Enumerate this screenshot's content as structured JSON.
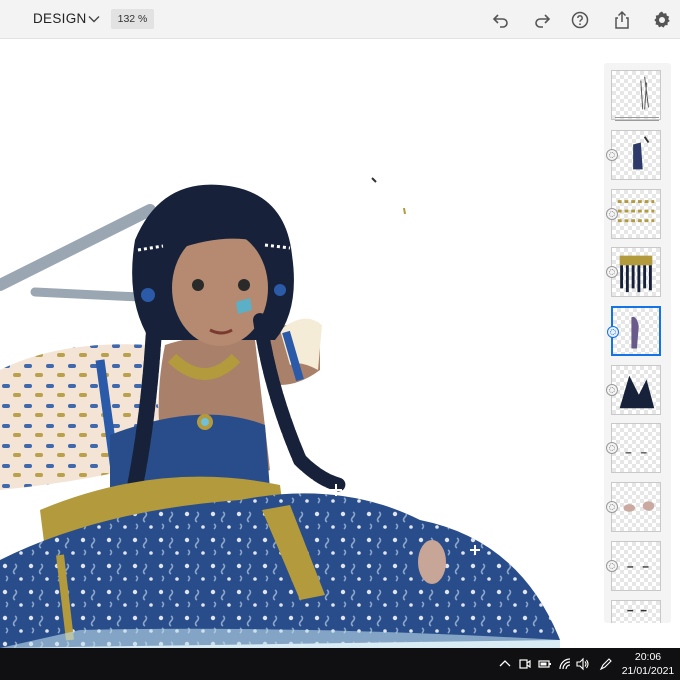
{
  "header": {
    "document_title": "DESIGN",
    "zoom": "132 %",
    "icons": [
      "chevron-down-icon",
      "undo-icon",
      "redo-icon",
      "help-icon",
      "share-icon",
      "gear-icon"
    ]
  },
  "layers_panel": {
    "layer_count": 10,
    "selected_layer": 5
  },
  "taskbar": {
    "time": "20:06",
    "date": "21/01/2021",
    "tray_icons": [
      "chevron-up-icon",
      "meet-now-icon",
      "battery-icon",
      "wifi-icon",
      "volume-icon",
      "pen-icon"
    ]
  },
  "colors": {
    "accent": "#1473e6",
    "topbar": "#f3f3f3",
    "taskbar": "#101012",
    "hair": "#17223a",
    "dress_blue": "#284d8a",
    "gold": "#b39a3c",
    "skin": "#a9806a"
  }
}
